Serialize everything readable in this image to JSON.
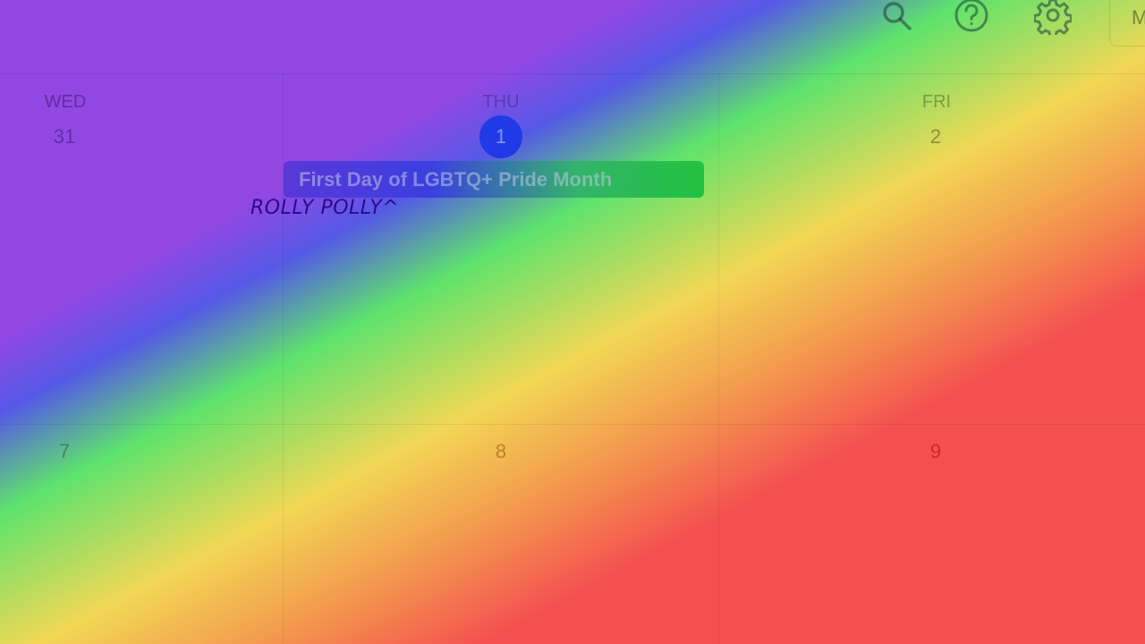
{
  "toolbar": {
    "search_icon": "search-icon",
    "help_icon": "help-icon",
    "settings_icon": "gear-icon",
    "view_select_label": "M"
  },
  "week1": {
    "days": [
      {
        "name": "WED",
        "num": "31"
      },
      {
        "name": "THU",
        "num": "1"
      },
      {
        "name": "FRI",
        "num": "2"
      }
    ],
    "event": "First Day of LGBTQ+ Pride Month"
  },
  "week2": {
    "days": [
      {
        "num": "7"
      },
      {
        "num": "8"
      },
      {
        "num": "9"
      }
    ]
  },
  "annotation": "ROLLY POLLY^",
  "colors": {
    "gradient": [
      "#9148e3",
      "#5559e6",
      "#5ee36c",
      "#f2d755",
      "#f39c4e",
      "#f45050"
    ],
    "today_circle": "#1f3ae6",
    "annotation_text": "#2a0a8c"
  }
}
